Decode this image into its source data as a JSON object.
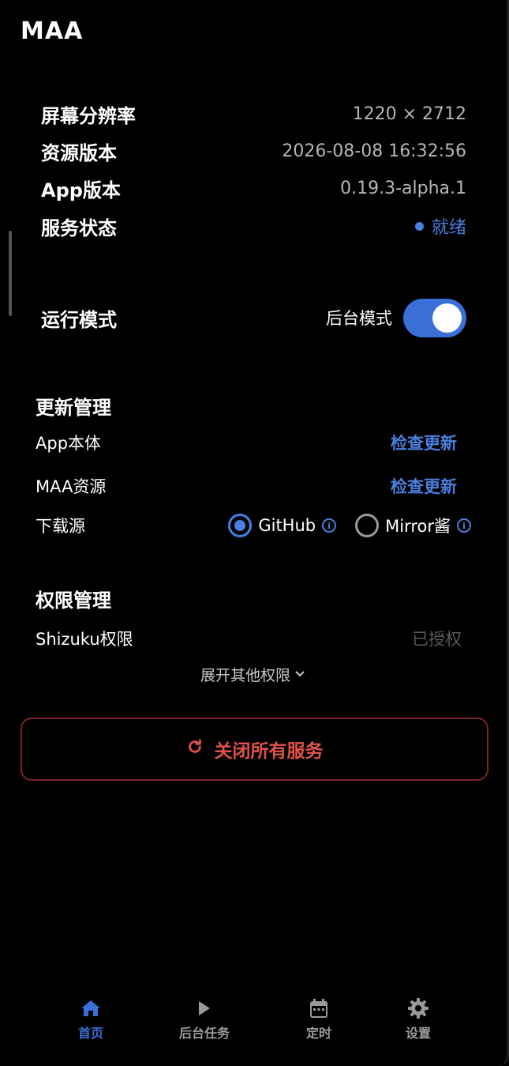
{
  "app": {
    "title": "MAA"
  },
  "device_info": [
    {
      "label": "屏幕分辨率",
      "value": "1220 × 2712"
    },
    {
      "label": "资源版本",
      "value": "2026-08-08 16:32:56"
    },
    {
      "label": "App版本",
      "value": "0.19.3-alpha.1"
    }
  ],
  "service_status": {
    "label": "服务状态",
    "value": "就绪",
    "color": "#4a7fe0"
  },
  "run_mode": {
    "label": "运行模式",
    "mode_text": "后台模式",
    "enabled": true
  },
  "update": {
    "title": "更新管理",
    "app_label": "App本体",
    "app_action": "检查更新",
    "res_label": "MAA资源",
    "res_action": "检查更新",
    "source_label": "下载源",
    "options": [
      {
        "label": "GitHub",
        "selected": true
      },
      {
        "label": "Mirror酱",
        "selected": false
      }
    ]
  },
  "permissions": {
    "title": "权限管理",
    "shizuku_label": "Shizuku权限",
    "shizuku_status": "已授权",
    "expand_label": "展开其他权限"
  },
  "stop_button": {
    "label": "关闭所有服务",
    "color": "#e0524a"
  },
  "nav": [
    {
      "label": "首页",
      "icon": "home-icon",
      "active": true
    },
    {
      "label": "后台任务",
      "icon": "play-icon",
      "active": false
    },
    {
      "label": "定时",
      "icon": "calendar-icon",
      "active": false
    },
    {
      "label": "设置",
      "icon": "gear-icon",
      "active": false
    }
  ],
  "colors": {
    "accent": "#3a6fd8",
    "danger": "#e0524a",
    "background": "#000000"
  }
}
